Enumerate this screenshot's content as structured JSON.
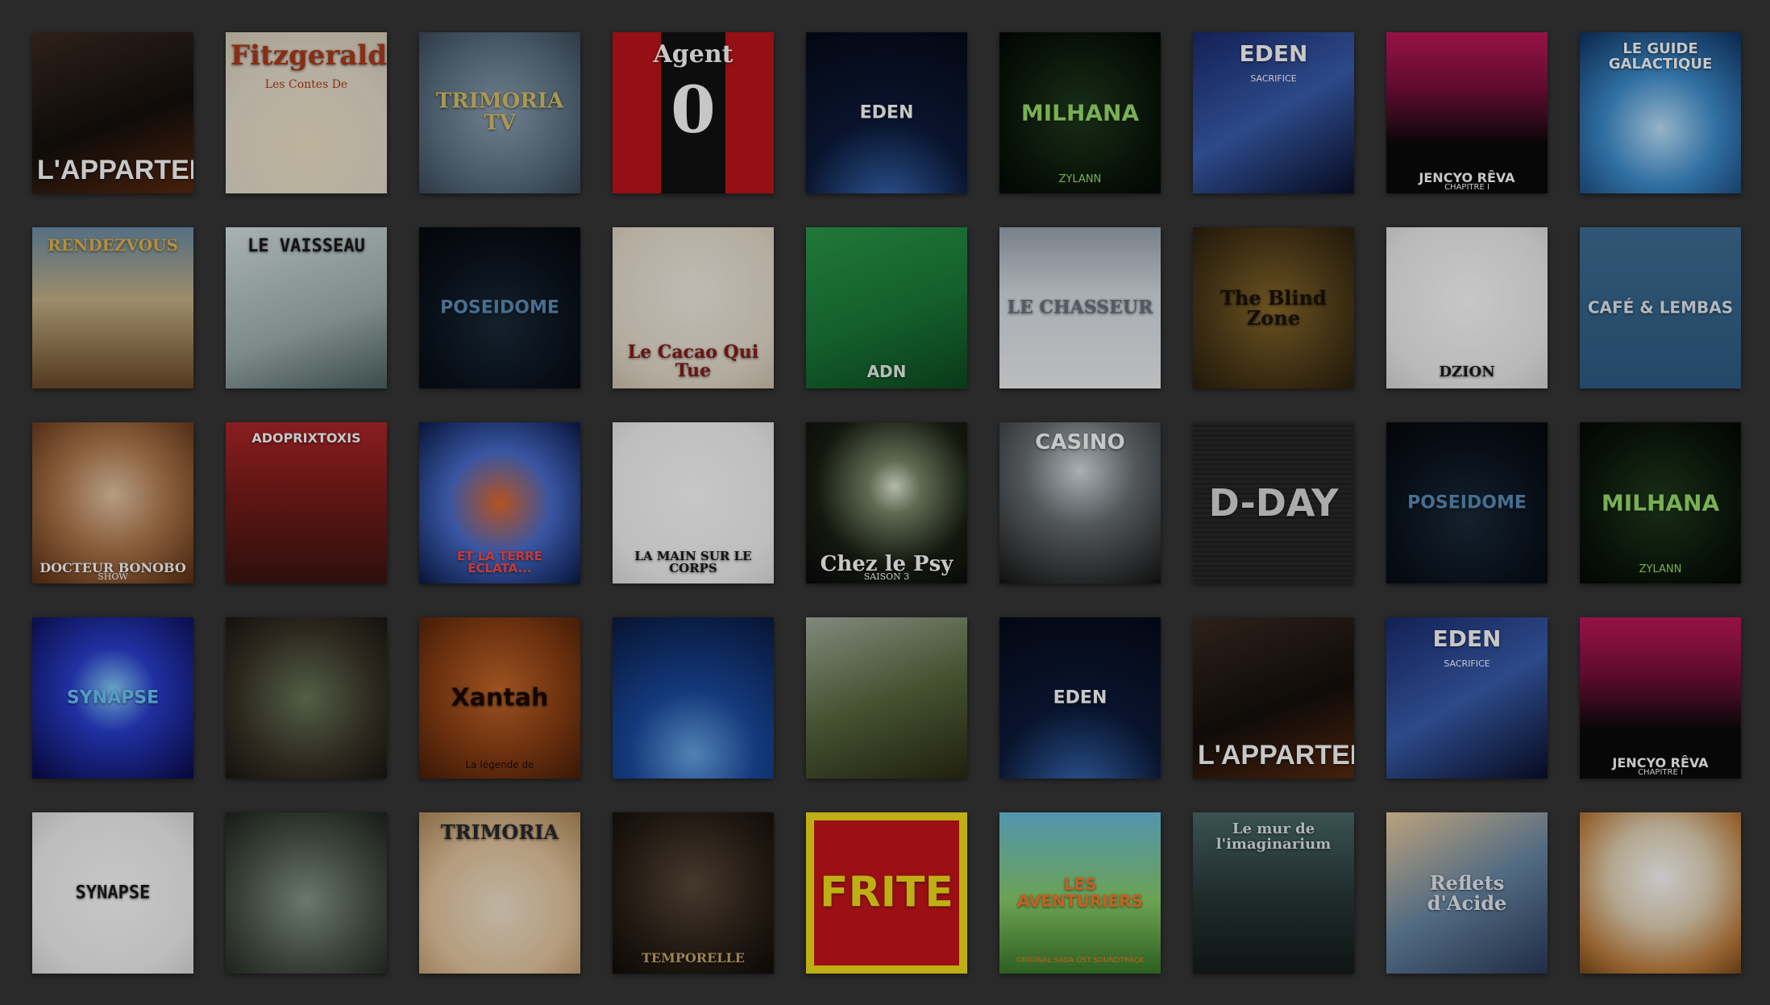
{
  "grid": {
    "tiles": [
      {
        "title": "L'APPARTEMENT",
        "sub": "",
        "bg": "linear-gradient(160deg,#3a2a22 0%,#140f0c 55%,#5a2a10 100%)",
        "color": "#ffffff",
        "font": "'Liberation Sans', sans-serif",
        "size": 34,
        "pos": "bottom",
        "subsize": 12
      },
      {
        "title": "Fitzgerald",
        "sub": "Les Contes De",
        "bg": "radial-gradient(circle at 50% 70%,#f2e6c8 0%,#e8e0d0 60%,#d8cdb8 100%)",
        "color": "#b03a1a",
        "font": "'DejaVu Serif', serif",
        "size": 34,
        "pos": "top",
        "subsize": 14
      },
      {
        "title": "TRIMORIA TV",
        "sub": "",
        "bg": "radial-gradient(circle at 50% 50%,#8fa4b8 0%,#5d7386 60%,#3b4b59 100%)",
        "color": "#d8c46a",
        "font": "'DejaVu Serif', serif",
        "size": 26,
        "pos": "middle",
        "subsize": 12
      },
      {
        "title": "Agent",
        "sub": "0",
        "bg": "linear-gradient(90deg,#c0141a 0%,#c0141a 30%,#111 30%,#111 70%,#c0141a 70%)",
        "color": "#ffffff",
        "font": "'DejaVu Serif', serif",
        "size": 30,
        "pos": "top",
        "subsize": 80
      },
      {
        "title": "EDEN",
        "sub": "",
        "bg": "radial-gradient(circle at 50% 110%,#3a6fbf 0%,#0c1a3a 45%,#060a18 100%)",
        "color": "#ffffff",
        "font": "'DejaVu Sans', sans-serif",
        "size": 22,
        "pos": "middle",
        "subsize": 12
      },
      {
        "title": "MILHANA",
        "sub": "ZYLANN",
        "bg": "radial-gradient(circle at 50% 50%,#1f3b1c 0%,#0a140a 70%,#050805 100%)",
        "color": "#9be06a",
        "font": "'DejaVu Sans', sans-serif",
        "size": 28,
        "pos": "middle",
        "subsize": 13
      },
      {
        "title": "EDEN",
        "sub": "SACRIFICE",
        "bg": "linear-gradient(150deg,#1a2a6e 0%,#3a5fb0 50%,#0a0f2a 100%)",
        "color": "#ffffff",
        "font": "'DejaVu Sans', sans-serif",
        "size": 28,
        "pos": "top",
        "subsize": 11
      },
      {
        "title": "JENCYO RÊVA",
        "sub": "CHAPITRE I",
        "bg": "linear-gradient(180deg,#c2185b 0%,#7a0f3c 35%,#0a0a0a 70%)",
        "color": "#ffffff",
        "font": "'DejaVu Sans', sans-serif",
        "size": 16,
        "pos": "bottom",
        "subsize": 10
      },
      {
        "title": "LE GUIDE GALACTIQUE",
        "sub": "",
        "bg": "radial-gradient(circle at 50% 60%,#bfe6ff 0%,#3e8fd0 45%,#0f3260 100%)",
        "color": "#ffffff",
        "font": "'DejaVu Sans', sans-serif",
        "size": 18,
        "pos": "top",
        "subsize": 12
      },
      {
        "title": "RENDEZVOUS",
        "sub": "",
        "bg": "linear-gradient(180deg,#6c8faa 0%,#c9b487 45%,#6b4a2a 100%)",
        "color": "#e8b84a",
        "font": "'DejaVu Serif', serif",
        "size": 20,
        "pos": "top",
        "subsize": 12
      },
      {
        "title": "LE VAISSEAU",
        "sub": "",
        "bg": "linear-gradient(160deg,#d9e4e4 0%,#9fb2b0 60%,#4e6260 100%)",
        "color": "#1a1a1a",
        "font": "'DejaVu Sans Mono', monospace",
        "size": 22,
        "pos": "top",
        "subsize": 12
      },
      {
        "title": "POSEIDOME",
        "sub": "",
        "bg": "radial-gradient(circle at 50% 60%,#1a2a3a 0%,#0a121c 60%,#05080c 100%)",
        "color": "#5a8fb8",
        "font": "'DejaVu Sans', sans-serif",
        "size": 22,
        "pos": "middle",
        "subsize": 12
      },
      {
        "title": "Le Cacao Qui Tue",
        "sub": "",
        "bg": "radial-gradient(circle at 50% 40%,#f4efe6 0%,#e6ddcc 70%,#cfc3ad 100%)",
        "color": "#8a1a1a",
        "font": "'DejaVu Serif', serif",
        "size": 22,
        "pos": "bottom",
        "subsize": 12
      },
      {
        "title": "ADN",
        "sub": "",
        "bg": "linear-gradient(160deg,#2a9a4a 0%,#1a7a38 55%,#0e4a22 100%)",
        "color": "#e8f4e8",
        "font": "'DejaVu Sans', sans-serif",
        "size": 20,
        "pos": "bottom",
        "subsize": 12
      },
      {
        "title": "LE CHASSEUR",
        "sub": "",
        "bg": "linear-gradient(180deg,#9aa4b0 0%,#d8dee4 40%,#f0f2f4 100%)",
        "color": "#6a7480",
        "font": "'DejaVu Serif', serif",
        "size": 22,
        "pos": "middle",
        "subsize": 12
      },
      {
        "title": "The Blind Zone",
        "sub": "",
        "bg": "radial-gradient(circle at 50% 50%,#8a6a2a 0%,#4a3818 65%,#2a200e 100%)",
        "color": "#1a1208",
        "font": "'DejaVu Serif', serif",
        "size": 24,
        "pos": "middle",
        "subsize": 12
      },
      {
        "title": "DZION",
        "sub": "",
        "bg": "radial-gradient(circle at 50% 45%,#ffffff 0%,#eeeeee 70%,#d8d8d8 100%)",
        "color": "#1a1a1a",
        "font": "'DejaVu Serif', serif",
        "size": 18,
        "pos": "bottom",
        "subsize": 12
      },
      {
        "title": "CAFÉ & LEMBAS",
        "sub": "",
        "bg": "linear-gradient(180deg,#3f6f96 0%,#2e5d85 100%)",
        "color": "#e0ecf4",
        "font": "'DejaVu Sans', sans-serif",
        "size": 20,
        "pos": "middle",
        "subsize": 12
      },
      {
        "title": "DOCTEUR BONOBO",
        "sub": "SHOW",
        "bg": "radial-gradient(circle at 50% 45%,#e8c9a8 0%,#b27a4e 45%,#5a2e12 100%)",
        "color": "#ffffff",
        "font": "'DejaVu Serif', serif",
        "size": 16,
        "pos": "bottom",
        "subsize": 11
      },
      {
        "title": "ADOPRIXTOXIS",
        "sub": "",
        "bg": "linear-gradient(180deg,#b0262a 0%,#7a1c1a 45%,#3a1510 100%)",
        "color": "#ffffff",
        "font": "'DejaVu Sans', sans-serif",
        "size": 16,
        "pos": "top",
        "subsize": 12
      },
      {
        "title": "ET LA TERRE ÉCLATA...",
        "sub": "",
        "bg": "radial-gradient(circle at 50% 50%,#e86a2a 0%,#4a6fd0 45%,#0a1a4a 100%)",
        "color": "#ff4a4a",
        "font": "'DejaVu Sans', sans-serif",
        "size": 15,
        "pos": "bottom",
        "subsize": 12
      },
      {
        "title": "LA MAIN SUR LE CORPS",
        "sub": "",
        "bg": "radial-gradient(circle at 50% 45%,#ffffff 0%,#f4f4f4 70%,#dedede 100%)",
        "color": "#1a1a1a",
        "font": "'DejaVu Serif', serif",
        "size": 15,
        "pos": "bottom",
        "subsize": 12
      },
      {
        "title": "Chez le Psy",
        "sub": "SAISON 3",
        "bg": "radial-gradient(circle at 55% 40%,#e8eedc 0%,#7a8a6a 20%,#1a1f14 60%,#08090a 100%)",
        "color": "#ffffff",
        "font": "'DejaVu Serif', serif",
        "size": 26,
        "pos": "bottom",
        "subsize": 11
      },
      {
        "title": "CASINO",
        "sub": "",
        "bg": "radial-gradient(circle at 50% 30%,#d8e0e4 0%,#6a7074 40%,#141414 100%)",
        "color": "#ffffff",
        "font": "'DejaVu Sans', sans-serif",
        "size": 26,
        "pos": "top",
        "subsize": 12
      },
      {
        "title": "D-DAY",
        "sub": "",
        "bg": "repeating-linear-gradient(180deg,#2a2a2a 0px,#2a2a2a 3px,#222 3px,#222 6px)",
        "color": "#dcdcdc",
        "font": "'DejaVu Sans', sans-serif",
        "size": 46,
        "pos": "middle",
        "subsize": 12
      },
      {
        "title": "POSEIDOME",
        "sub": "",
        "bg": "radial-gradient(circle at 50% 60%,#1a2a3a 0%,#0a121c 60%,#05080c 100%)",
        "color": "#5a8fb8",
        "font": "'DejaVu Sans', sans-serif",
        "size": 22,
        "pos": "middle",
        "subsize": 12
      },
      {
        "title": "MILHANA",
        "sub": "ZYLANN",
        "bg": "radial-gradient(circle at 50% 50%,#1f3b1c 0%,#0a140a 70%,#050805 100%)",
        "color": "#9be06a",
        "font": "'DejaVu Sans', sans-serif",
        "size": 28,
        "pos": "middle",
        "subsize": 13
      },
      {
        "title": "SYNAPSE",
        "sub": "",
        "bg": "radial-gradient(circle at 50% 45%,#8ad4ff 0%,#2a3fd0 35%,#0a0a4a 100%)",
        "color": "#6ac8ff",
        "font": "'DejaVu Sans', sans-serif",
        "size": 22,
        "pos": "middle",
        "subsize": 10
      },
      {
        "title": "",
        "sub": "",
        "bg": "radial-gradient(circle at 50% 50%,#6a7a5a 0%,#3a3428 60%,#1a1712 100%)",
        "color": "#ffffff",
        "font": "'DejaVu Sans', sans-serif",
        "size": 20,
        "pos": "middle",
        "subsize": 12
      },
      {
        "title": "Xantah",
        "sub": "La légende de",
        "bg": "radial-gradient(circle at 50% 45%,#c96a2a 0%,#8a3f14 55%,#4a1e08 100%)",
        "color": "#1a0a04",
        "font": "'DejaVu Sans', sans-serif",
        "size": 30,
        "pos": "middle",
        "subsize": 12
      },
      {
        "title": "",
        "sub": "",
        "bg": "radial-gradient(circle at 50% 85%,#6aa8e8 0%,#1a4aa0 40%,#0a1a40 100%)",
        "color": "#ffffff",
        "font": "'DejaVu Sans', sans-serif",
        "size": 20,
        "pos": "middle",
        "subsize": 12
      },
      {
        "title": "",
        "sub": "",
        "bg": "linear-gradient(160deg,#a8b0a0 0%,#5a6a40 50%,#2a2a14 100%)",
        "color": "#ffffff",
        "font": "'DejaVu Sans', sans-serif",
        "size": 20,
        "pos": "middle",
        "subsize": 12
      },
      {
        "title": "EDEN",
        "sub": "",
        "bg": "radial-gradient(circle at 50% 110%,#3a6fbf 0%,#0c1a3a 45%,#060a18 100%)",
        "color": "#ffffff",
        "font": "'DejaVu Sans', sans-serif",
        "size": 22,
        "pos": "middle",
        "subsize": 12
      },
      {
        "title": "L'APPARTEMENT",
        "sub": "",
        "bg": "linear-gradient(160deg,#3a2a22 0%,#140f0c 55%,#5a2a10 100%)",
        "color": "#ffffff",
        "font": "'Liberation Sans', sans-serif",
        "size": 34,
        "pos": "bottom",
        "subsize": 12
      },
      {
        "title": "EDEN",
        "sub": "SACRIFICE",
        "bg": "linear-gradient(150deg,#1a2a6e 0%,#3a5fb0 50%,#0a0f2a 100%)",
        "color": "#ffffff",
        "font": "'DejaVu Sans', sans-serif",
        "size": 28,
        "pos": "top",
        "subsize": 11
      },
      {
        "title": "JENCYO RÊVA",
        "sub": "CHAPITRE I",
        "bg": "linear-gradient(180deg,#c2185b 0%,#7a0f3c 35%,#0a0a0a 70%)",
        "color": "#ffffff",
        "font": "'DejaVu Sans', sans-serif",
        "size": 16,
        "pos": "bottom",
        "subsize": 10
      },
      {
        "title": "SYNAPSE",
        "sub": "",
        "bg": "radial-gradient(circle at 50% 50%,#ffffff 0%,#f2f2f2 70%,#dcdcdc 100%)",
        "color": "#1a1a1a",
        "font": "'DejaVu Sans Mono', monospace",
        "size": 22,
        "pos": "middle",
        "subsize": 10
      },
      {
        "title": "",
        "sub": "",
        "bg": "radial-gradient(circle at 50% 55%,#8a9a8a 0%,#4a5448 55%,#1e231e 100%)",
        "color": "#ffffff",
        "font": "'DejaVu Sans', sans-serif",
        "size": 20,
        "pos": "middle",
        "subsize": 12
      },
      {
        "title": "TRIMORIA",
        "sub": "",
        "bg": "radial-gradient(circle at 50% 60%,#f4e6d0 0%,#e8c8a0 55%,#b08a5a 100%)",
        "color": "#2a2a2a",
        "font": "'DejaVu Serif', serif",
        "size": 24,
        "pos": "top",
        "subsize": 12
      },
      {
        "title": "TEMPORELLE",
        "sub": "",
        "bg": "radial-gradient(circle at 50% 45%,#5a4a3a 0%,#2a2018 60%,#100c08 100%)",
        "color": "#c8a86a",
        "font": "'DejaVu Serif', serif",
        "size": 16,
        "pos": "bottom",
        "subsize": 12
      },
      {
        "title": "FRITE",
        "sub": "",
        "bg": "linear-gradient(180deg,#f4e01a 0%,#f4e01a 100%)",
        "color": "#f4e01a",
        "font": "'DejaVu Sans', sans-serif",
        "size": 52,
        "pos": "middle",
        "subsize": 12
      },
      {
        "title": "LES AVENTURIERS",
        "sub": "ORIGINAL SAGA OST SOUNDTRACK",
        "bg": "linear-gradient(180deg,#6ac0e0 0%,#8ad06a 55%,#3a7a2a 100%)",
        "color": "#ff7a2a",
        "font": "'DejaVu Sans', sans-serif",
        "size": 20,
        "pos": "middle",
        "subsize": 9
      },
      {
        "title": "Le mur de l'imaginarium",
        "sub": "",
        "bg": "linear-gradient(180deg,#4a6a6a 0%,#2a3a3a 50%,#141a1a 100%)",
        "color": "#dfe8ea",
        "font": "'DejaVu Serif', serif",
        "size": 18,
        "pos": "top",
        "subsize": 12
      },
      {
        "title": "Reflets d'Acide",
        "sub": "",
        "bg": "linear-gradient(150deg,#f0d0a0 0%,#6a8aa8 50%,#2a3a5a 100%)",
        "color": "#e8eef4",
        "font": "'DejaVu Serif', serif",
        "size": 24,
        "pos": "middle",
        "subsize": 12
      },
      {
        "title": "",
        "sub": "",
        "bg": "radial-gradient(circle at 50% 40%,#ffffff 0%,#e6d6b8 40%,#c08040 75%,#7a4a1a 100%)",
        "color": "#ffffff",
        "font": "'DejaVu Sans', sans-serif",
        "size": 20,
        "pos": "middle",
        "subsize": 12
      }
    ]
  }
}
